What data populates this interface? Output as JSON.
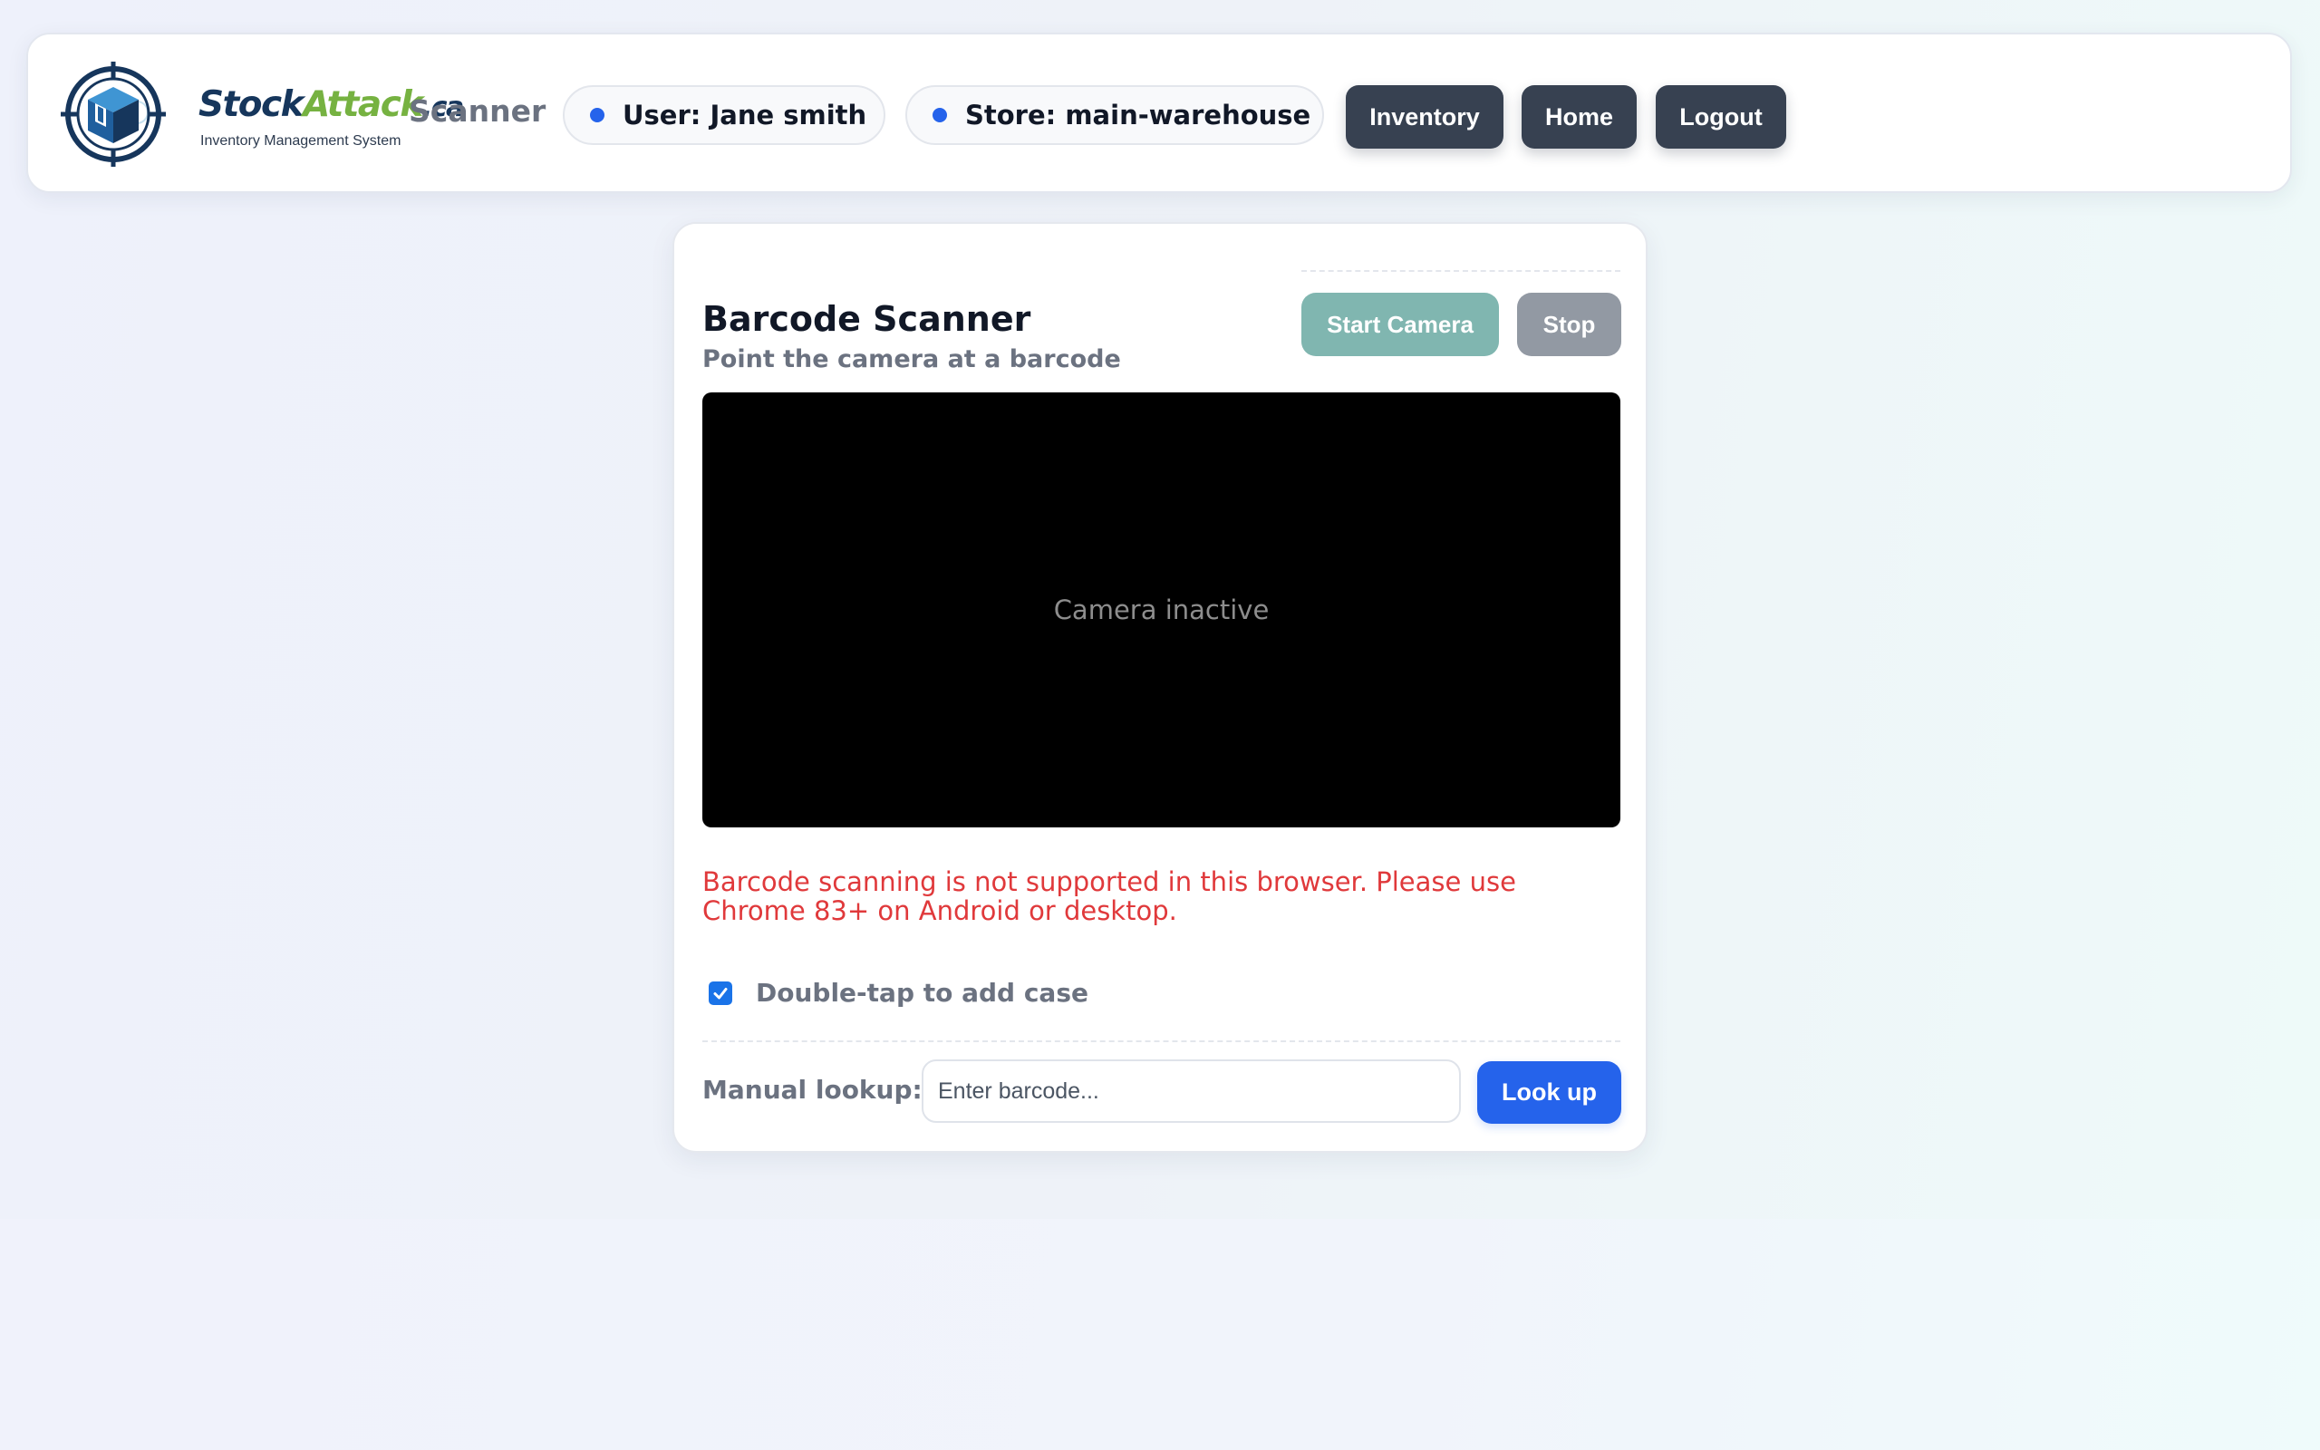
{
  "header": {
    "logo": {
      "brand_part1": "Stock",
      "brand_part2": "Attack",
      "brand_suffix": ".ca",
      "tagline": "Inventory Management System"
    },
    "page_label": "Scanner",
    "user_pill": "User: Jane smith",
    "store_pill": "Store: main-warehouse",
    "nav": {
      "inventory": "Inventory",
      "home": "Home",
      "logout": "Logout"
    }
  },
  "scanner": {
    "title": "Barcode Scanner",
    "subtitle": "Point the camera at a barcode",
    "start_button": "Start Camera",
    "stop_button": "Stop",
    "camera_status": "Camera inactive",
    "error_message": "Barcode scanning is not supported in this browser. Please use Chrome 83+ on Android or desktop.",
    "double_tap": {
      "label": "Double-tap to add case",
      "checked": true
    },
    "manual_lookup": {
      "label": "Manual lookup:",
      "placeholder": "Enter barcode...",
      "value": "",
      "button": "Look up"
    }
  },
  "colors": {
    "brand_navy": "#16365c",
    "brand_green": "#76b241",
    "dark_button": "#374151",
    "primary_blue": "#2563eb",
    "start_button_teal": "#80b6b0",
    "stop_button_gray": "#9299a3",
    "error_red": "#e0393b",
    "status_dot": "#2563eb"
  },
  "icons": {
    "logo": "crosshair-box-logo",
    "status_dot": "dot-icon",
    "checkbox": "checkmark-icon"
  }
}
